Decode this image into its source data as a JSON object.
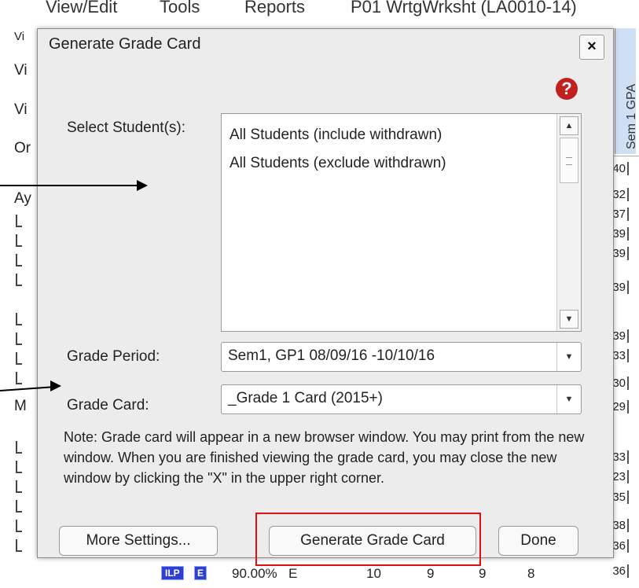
{
  "menu": {
    "items": [
      "View/Edit",
      "Tools",
      "Reports"
    ],
    "context_title": "P01 WrtgWrksht (LA0010-14)"
  },
  "background": {
    "left_labels": [
      "Vi",
      "Vi",
      "Vi",
      "Or",
      "Ay",
      "M"
    ],
    "right_header": "Sem 1 GPA",
    "right_values": [
      "40",
      "32",
      "37",
      "39",
      "39",
      "39",
      "39",
      "33",
      "30",
      "29",
      "33",
      "23",
      "35",
      "38",
      "36",
      "36"
    ],
    "bottom_row": {
      "badge_ilp": "ILP",
      "badge_e": "E",
      "percent": "90.00%",
      "grade": "E",
      "scores": [
        "10",
        "9",
        "9",
        "8"
      ]
    }
  },
  "dialog": {
    "title": "Generate Grade Card",
    "close_symbol": "×",
    "help_symbol": "?",
    "select_students_label": "Select Student(s):",
    "students": [
      {
        "label": "All Students (include withdrawn)"
      },
      {
        "label": "All Students (exclude withdrawn)"
      }
    ],
    "grade_period_label": "Grade Period:",
    "grade_period_value": "Sem1, GP1  08/09/16  -10/10/16",
    "grade_card_label": "Grade Card:",
    "grade_card_value": "_Grade 1 Card (2015+)",
    "note": "Note: Grade card will appear in a new browser window. You may print from the new window. When you are finished viewing the grade card, you may close the new window by clicking the \"X\" in the upper right corner.",
    "buttons": {
      "more_settings": "More Settings...",
      "generate": "Generate Grade Card",
      "done": "Done"
    }
  },
  "colors": {
    "highlight": "#e01010",
    "help_icon": "#c21f1f",
    "header_cell": "#cfe0f5",
    "badge": "#2f3fd4"
  }
}
